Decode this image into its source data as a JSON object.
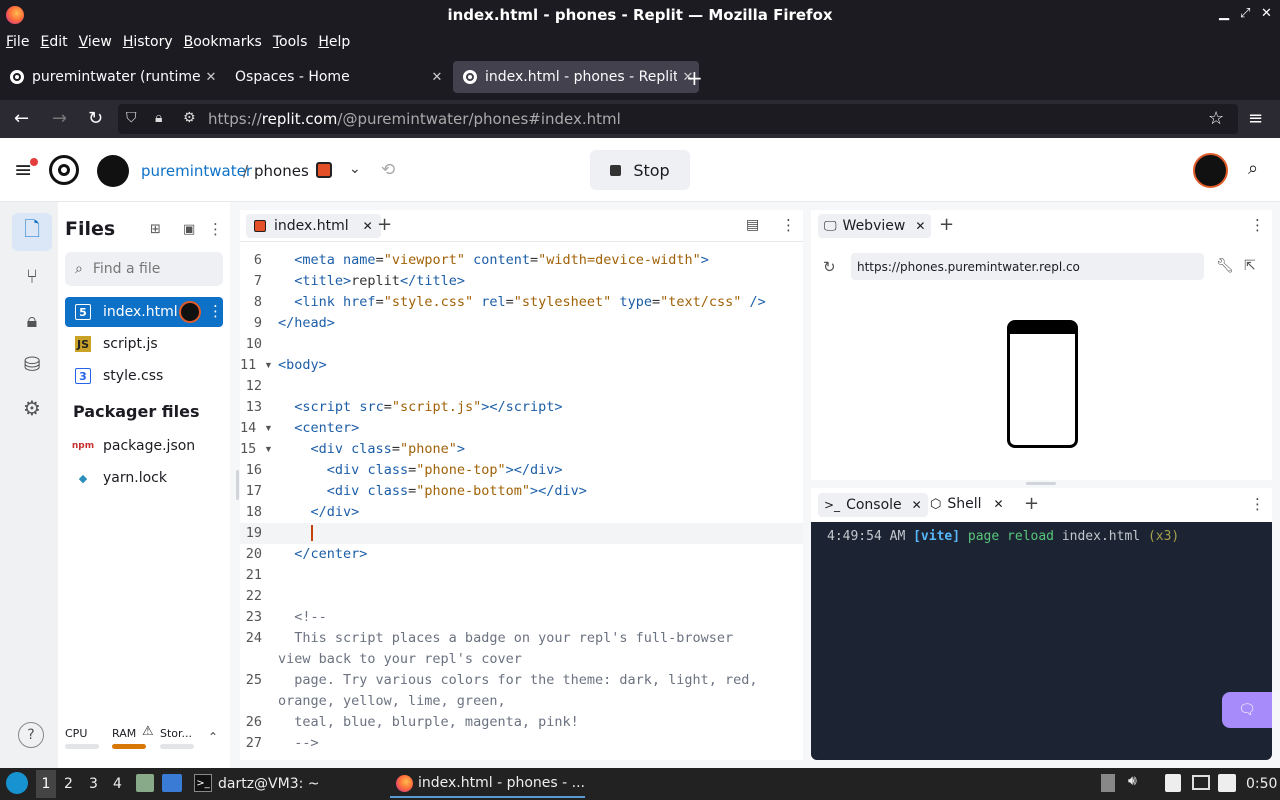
{
  "window": {
    "title": "index.html - phones - Replit — Mozilla Firefox"
  },
  "menu": [
    "File",
    "Edit",
    "View",
    "History",
    "Bookmarks",
    "Tools",
    "Help"
  ],
  "tabs": [
    {
      "label": "puremintwater (runtime)"
    },
    {
      "label": "Ospaces - Home"
    },
    {
      "label": "index.html - phones - Replit"
    }
  ],
  "url": {
    "prefix": "https://",
    "domain": "replit.com",
    "path": "/@puremintwater/phones#index.html"
  },
  "repl": {
    "owner": "puremintwater",
    "sep": "/",
    "name": "phones",
    "stop_label": "Stop"
  },
  "files": {
    "title": "Files",
    "search_placeholder": "Find a file",
    "items": [
      {
        "name": "index.html"
      },
      {
        "name": "script.js"
      },
      {
        "name": "style.css"
      }
    ],
    "packager_title": "Packager files",
    "packager": [
      {
        "name": "package.json"
      },
      {
        "name": "yarn.lock"
      }
    ],
    "cpu": "CPU",
    "ram": "RAM",
    "storage": "Stor..."
  },
  "editor": {
    "tab": "index.html",
    "lines": [
      {
        "n": "6",
        "html": "  <span class='tg'>&lt;meta</span> <span class='at'>name</span>=<span class='st'>\"viewport\"</span> <span class='at'>content</span>=<span class='st'>\"width=device-width\"</span><span class='tg'>&gt;</span>"
      },
      {
        "n": "7",
        "html": "  <span class='tg'>&lt;title&gt;</span>replit<span class='tg'>&lt;/title&gt;</span>"
      },
      {
        "n": "8",
        "html": "  <span class='tg'>&lt;link</span> <span class='at'>href</span>=<span class='st'>\"style.css\"</span> <span class='at'>rel</span>=<span class='st'>\"stylesheet\"</span> <span class='at'>type</span>=<span class='st'>\"text/css\"</span> <span class='tg'>/&gt;</span>"
      },
      {
        "n": "9",
        "html": "<span class='tg'>&lt;/head&gt;</span>"
      },
      {
        "n": "10",
        "html": ""
      },
      {
        "n": "11 ▾",
        "html": "<span class='tg'>&lt;body&gt;</span>"
      },
      {
        "n": "12",
        "html": ""
      },
      {
        "n": "13",
        "html": "  <span class='tg'>&lt;script</span> <span class='at'>src</span>=<span class='st'>\"script.js\"</span><span class='tg'>&gt;&lt;/script&gt;</span>"
      },
      {
        "n": "14 ▾",
        "html": "  <span class='tg'>&lt;center&gt;</span>"
      },
      {
        "n": "15 ▾",
        "html": "    <span class='tg'>&lt;div</span> <span class='at'>class</span>=<span class='st'>\"phone\"</span><span class='tg'>&gt;</span>"
      },
      {
        "n": "16",
        "html": "      <span class='tg'>&lt;div</span> <span class='at'>class</span>=<span class='st'>\"phone-top\"</span><span class='tg'>&gt;&lt;/div&gt;</span>"
      },
      {
        "n": "17",
        "html": "      <span class='tg'>&lt;div</span> <span class='at'>class</span>=<span class='st'>\"phone-bottom\"</span><span class='tg'>&gt;&lt;/div&gt;</span>"
      },
      {
        "n": "18",
        "html": "    <span class='tg'>&lt;/div&gt;</span>"
      },
      {
        "n": "19",
        "html": "    <span style='border-left:2px solid #c2410c'> </span>"
      },
      {
        "n": "20",
        "html": "  <span class='tg'>&lt;/center&gt;</span>"
      },
      {
        "n": "21",
        "html": ""
      },
      {
        "n": "22",
        "html": ""
      },
      {
        "n": "23",
        "html": "  <span class='cm'>&lt;!--</span>"
      },
      {
        "n": "24",
        "html": "<span class='cm'>  This script places a badge on your repl's full-browser</span>"
      },
      {
        "n": "",
        "html": "<span class='cm'>view back to your repl's cover</span>"
      },
      {
        "n": "25",
        "html": "<span class='cm'>  page. Try various colors for the theme: dark, light, red,</span>"
      },
      {
        "n": "",
        "html": "<span class='cm'>orange, yellow, lime, green,</span>"
      },
      {
        "n": "26",
        "html": "<span class='cm'>  teal, blue, blurple, magenta, pink!</span>"
      },
      {
        "n": "27",
        "html": "  <span class='cm'>--&gt;</span>"
      }
    ]
  },
  "webview": {
    "tab": "Webview",
    "url": "https://phones.puremintwater.repl.co"
  },
  "console": {
    "tab1": "Console",
    "tab2": "Shell",
    "time": "4:49:54 AM",
    "tag": "[vite]",
    "msg": "page reload",
    "file": "index.html",
    "count": "(x3)"
  },
  "taskbar": {
    "ws": [
      "1",
      "2",
      "3",
      "4"
    ],
    "term": "dartz@VM3: ~",
    "browser": "index.html - phones - ...",
    "clock": "0:50"
  }
}
